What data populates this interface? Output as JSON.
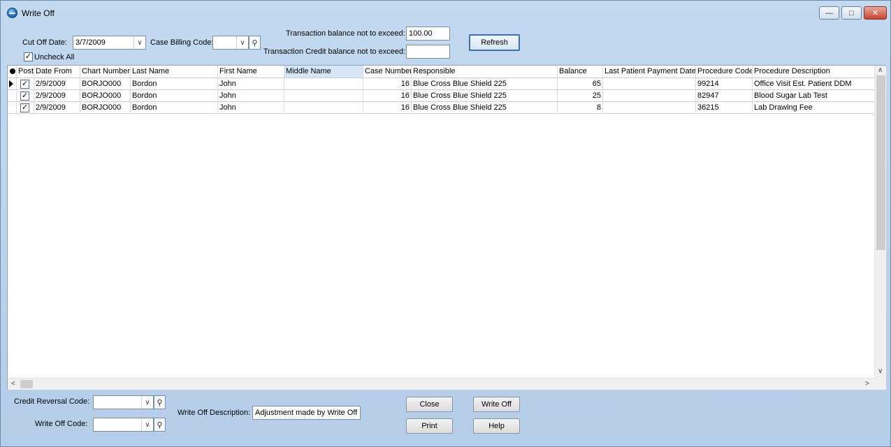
{
  "window": {
    "title": "Write Off",
    "min_glyph": "—",
    "max_glyph": "□",
    "close_glyph": "✕"
  },
  "filters": {
    "cutoff_label": "Cut Off Date:",
    "cutoff_value": "3/7/2009",
    "case_billing_label": "Case Billing Code:",
    "case_billing_value": "",
    "uncheck_all_label": "Uncheck All",
    "uncheck_all_checked": true,
    "txn_balance_label": "Transaction balance not to exceed:",
    "txn_balance_value": "100.00",
    "txn_credit_label": "Transaction Credit balance not to exceed:",
    "txn_credit_value": "",
    "refresh_label": "Refresh"
  },
  "grid": {
    "columns": [
      "Post",
      "Date From",
      "Chart Number",
      "Last Name",
      "First Name",
      "Middle Name",
      "Case Number",
      "Responsible",
      "Balance",
      "Last Patient Payment Date",
      "Procedure Code",
      "Procedure Description"
    ],
    "rows": [
      {
        "post": true,
        "date_from": "2/9/2009",
        "chart": "BORJO000",
        "last": "Bordon",
        "first": "John",
        "middle": "",
        "case": "16",
        "responsible": "Blue Cross Blue Shield 225",
        "balance": "65",
        "last_payment": "",
        "proc_code": "99214",
        "proc_desc": "Office Visit Est. Patient DDM"
      },
      {
        "post": true,
        "date_from": "2/9/2009",
        "chart": "BORJO000",
        "last": "Bordon",
        "first": "John",
        "middle": "",
        "case": "16",
        "responsible": "Blue Cross Blue Shield 225",
        "balance": "25",
        "last_payment": "",
        "proc_code": "82947",
        "proc_desc": "Blood Sugar Lab Test"
      },
      {
        "post": true,
        "date_from": "2/9/2009",
        "chart": "BORJO000",
        "last": "Bordon",
        "first": "John",
        "middle": "",
        "case": "16",
        "responsible": "Blue Cross Blue Shield 225",
        "balance": "8",
        "last_payment": "",
        "proc_code": "36215",
        "proc_desc": "Lab Drawing Fee"
      }
    ]
  },
  "bottom": {
    "credit_reversal_label": "Credit Reversal Code:",
    "credit_reversal_value": "",
    "write_off_code_label": "Write Off Code:",
    "write_off_code_value": "",
    "description_label": "Write Off Description:",
    "description_value": "Adjustment made by Write Off",
    "close_label": "Close",
    "write_off_label": "Write Off",
    "print_label": "Print",
    "help_label": "Help"
  },
  "icons": {
    "check": "✓",
    "dropdown": "∨",
    "lookup": "⚲",
    "scroll_up": "∧",
    "scroll_down": "∨",
    "scroll_left": "<",
    "scroll_right": ">"
  }
}
